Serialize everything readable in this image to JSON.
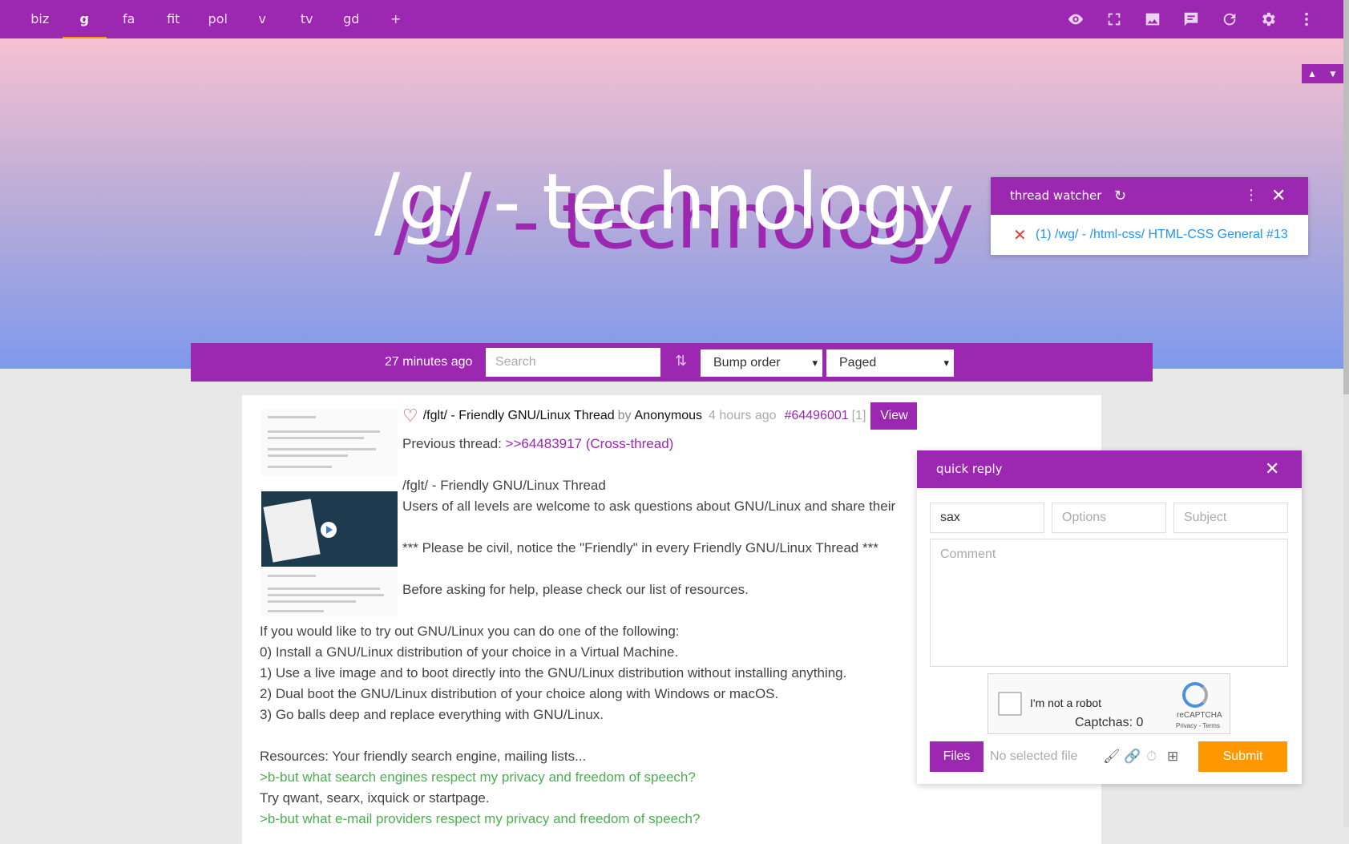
{
  "nav": {
    "boards": [
      "biz",
      "g",
      "fa",
      "fit",
      "pol",
      "v",
      "tv",
      "gd",
      "+"
    ],
    "active_board": "g",
    "icons": [
      "eye-icon",
      "fullscreen-icon",
      "image-icon",
      "chat-icon",
      "refresh-icon",
      "settings-icon",
      "more-vert-icon"
    ]
  },
  "banner": {
    "title": "/g/ - technology"
  },
  "toolbar": {
    "updated": "27 minutes ago",
    "search_placeholder": "Search",
    "sort_value": "Bump order",
    "mode_value": "Paged"
  },
  "post": {
    "subject": "/fglt/ - Friendly GNU/Linux Thread",
    "by": "by",
    "name": "Anonymous",
    "time": "4 hours ago",
    "number": "#64496001",
    "replies": "[1]",
    "view": "View",
    "lines": {
      "prev_label": "Previous thread: ",
      "prev_link": ">>64483917 (Cross-thread)",
      "l1": "/fglt/ - Friendly GNU/Linux Thread",
      "l2": "Users of all levels are welcome to ask questions about GNU/Linux and share their",
      "l3": "*** Please be civil, notice the \"Friendly\" in every Friendly GNU/Linux Thread ***",
      "l4": "Before asking for help, please check our list of resources.",
      "l5": "If you would like to try out GNU/Linux you can do one of the following:",
      "l6": "0) Install a GNU/Linux distribution of your choice in a Virtual Machine.",
      "l7": "1) Use a live image and to boot directly into the GNU/Linux distribution without installing anything.",
      "l8": "2) Dual boot the GNU/Linux distribution of your choice along with Windows or macOS.",
      "l9": "3) Go balls deep and replace everything with GNU/Linux.",
      "l10": "Resources: Your friendly search engine, mailing lists...",
      "l11": ">b-but what search engines respect my privacy and freedom of speech?",
      "l12": "Try qwant, searx, ixquick or startpage.",
      "l13": ">b-but what e-mail providers respect my privacy and freedom of speech?"
    }
  },
  "thread_watcher": {
    "title": "thread watcher",
    "item": "(1) /wg/ - /html-css/ HTML-CSS General #13"
  },
  "quick_reply": {
    "title": "quick reply",
    "name_value": "sax",
    "options_placeholder": "Options",
    "subject_placeholder": "Subject",
    "comment_placeholder": "Comment",
    "captcha_label": "I'm not a robot",
    "captcha_count": "Captchas: 0",
    "captcha_brand": "reCAPTCHA",
    "captcha_terms": "Privacy - Terms",
    "files": "Files",
    "no_file": "No selected file",
    "submit": "Submit"
  },
  "colors": {
    "primary": "#9c27b0",
    "accent": "#ff9800",
    "link": "#2196f3",
    "greentext": "#4caf50"
  }
}
